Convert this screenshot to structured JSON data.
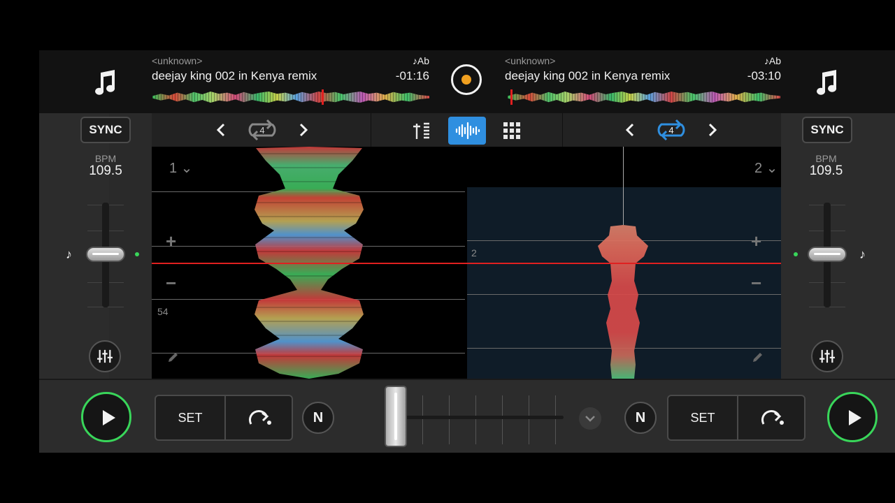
{
  "deck_a": {
    "artist": "<unknown>",
    "title": "deejay king 002 in Kenya remix",
    "key": "♪Ab",
    "time": "-01:16",
    "sync_label": "SYNC",
    "bpm_label": "BPM",
    "bpm": "109.5",
    "loop_beats": "4",
    "deck_number": "1 ⌄",
    "beat_marker": "54",
    "progress": 0.61
  },
  "deck_b": {
    "artist": "<unknown>",
    "title": "deejay king 002 in Kenya remix",
    "key": "♪Ab",
    "time": "-03:10",
    "sync_label": "SYNC",
    "bpm_label": "BPM",
    "bpm": "109.5",
    "loop_beats": "4",
    "deck_number": "2 ⌄",
    "beat_marker": "2",
    "progress": 0.01
  },
  "controls": {
    "set_label": "SET",
    "n_label": "N",
    "plus": "+",
    "minus": "−"
  },
  "colors": {
    "accent_blue": "#2f8fe0",
    "play_green": "#39d65a",
    "playhead_red": "#e02020",
    "record_orange": "#f0a020"
  },
  "icons": [
    "music-note-icon",
    "record-icon",
    "chevron-left-icon",
    "chevron-right-icon",
    "loop-icon",
    "mixer-view-icon",
    "waveform-view-icon",
    "pads-grid-icon",
    "eq-icon",
    "pencil-icon",
    "play-icon",
    "cue-jump-icon",
    "chevron-down-icon"
  ]
}
